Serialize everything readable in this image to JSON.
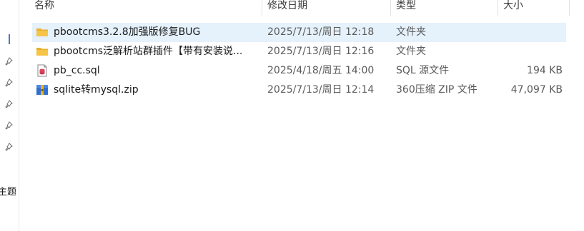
{
  "nav": {
    "topic_label": "主题"
  },
  "columns": {
    "name": "名称",
    "modified": "修改日期",
    "type": "类型",
    "size": "大小"
  },
  "files": [
    {
      "name": "pbootcms3.2.8加强版修复BUG",
      "modified": "2025/7/13/周日 12:18",
      "type": "文件夹",
      "size": "",
      "icon": "folder-icon",
      "selected": true
    },
    {
      "name": "pbootcms泛解析站群插件【带有安装说...",
      "modified": "2025/7/13/周日 12:16",
      "type": "文件夹",
      "size": "",
      "icon": "folder-icon",
      "selected": false
    },
    {
      "name": "pb_cc.sql",
      "modified": "2025/4/18/周五 14:00",
      "type": "SQL 源文件",
      "size": "194 KB",
      "icon": "sql-file-icon",
      "selected": false
    },
    {
      "name": "sqlite转mysql.zip",
      "modified": "2025/7/13/周日 12:14",
      "type": "360压缩 ZIP 文件",
      "size": "47,097 KB",
      "icon": "zip-archive-icon",
      "selected": false
    }
  ],
  "colors": {
    "selection": "#e5f1fb",
    "folder": "#f6c447",
    "accent": "#4a7bc8"
  }
}
